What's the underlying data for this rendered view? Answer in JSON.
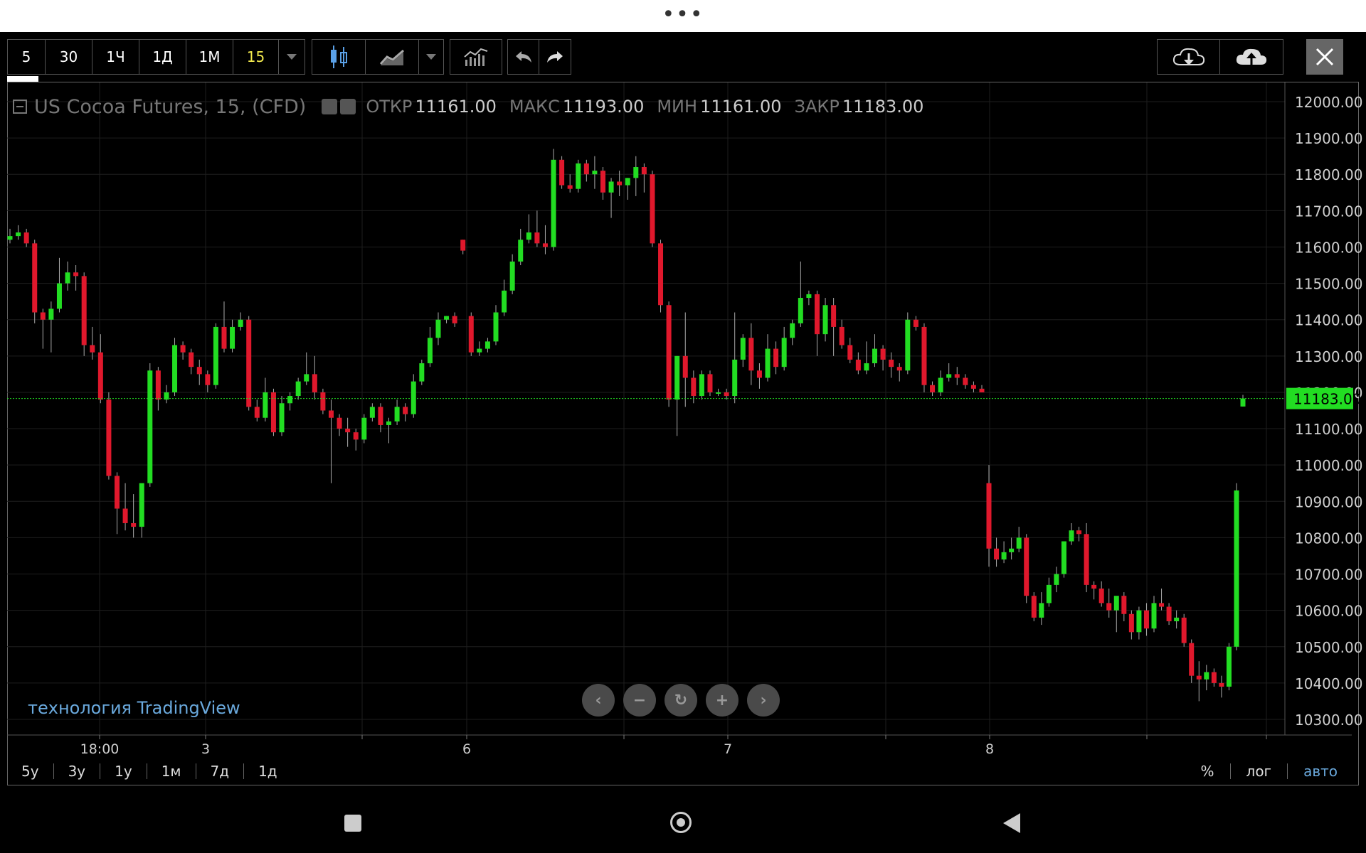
{
  "toolbar": {
    "intervals": [
      "5",
      "30",
      "1Ч",
      "1Д",
      "1М",
      "15"
    ],
    "active_interval": "15"
  },
  "legend": {
    "title": "US Cocoa Futures, 15, (CFD)",
    "open_label": "ОТКР",
    "open_value": "11161.00",
    "high_label": "МАКС",
    "high_value": "11193.00",
    "low_label": "МИН",
    "low_value": "11161.00",
    "close_label": "ЗАКР",
    "close_value": "11183.00"
  },
  "watermark": "технология TradingView",
  "ranges": [
    "5y",
    "3y",
    "1y",
    "1м",
    "7д",
    "1д"
  ],
  "scale_options": [
    "%",
    "лог",
    "авто"
  ],
  "active_scale": "авто",
  "colors": {
    "up": "#22dd22",
    "down": "#e0182c",
    "last_price": "#22dd22",
    "accent": "#6aa9dd",
    "active_interval": "#f2e94e"
  },
  "icons": [
    "chevron-down-icon",
    "candles-icon",
    "line-chart-icon",
    "indicators-icon",
    "undo-icon",
    "redo-icon",
    "cloud-download-icon",
    "cloud-upload-icon",
    "close-icon",
    "scroll-left-icon",
    "zoom-out-icon",
    "reset-icon",
    "zoom-in-icon",
    "scroll-right-icon"
  ],
  "chart_data": {
    "type": "candlestick",
    "symbol": "US Cocoa Futures",
    "interval": "15",
    "y_range": [
      10250,
      12050
    ],
    "y_ticks": [
      "12000.00",
      "11900.00",
      "11800.00",
      "11700.00",
      "11600.00",
      "11500.00",
      "11400.00",
      "11300.00",
      "11200.00",
      "11100.00",
      "11000.00",
      "10900.00",
      "10800.00",
      "10700.00",
      "10600.00",
      "10500.00",
      "10400.00",
      "10300.00"
    ],
    "x_ticks": [
      "18:00",
      "3",
      "6",
      "7",
      "8"
    ],
    "last_price": 11183.0,
    "last_price_label": "11183.00",
    "candles": [
      [
        11620,
        11650,
        11610,
        11630
      ],
      [
        11630,
        11660,
        11620,
        11640
      ],
      [
        11640,
        11650,
        11600,
        11610
      ],
      [
        11610,
        11620,
        11390,
        11420
      ],
      [
        11420,
        11430,
        11320,
        11400
      ],
      [
        11400,
        11450,
        11310,
        11430
      ],
      [
        11430,
        11570,
        11420,
        11500
      ],
      [
        11500,
        11560,
        11480,
        11530
      ],
      [
        11530,
        11550,
        11480,
        11520
      ],
      [
        11520,
        11530,
        11300,
        11330
      ],
      [
        11330,
        11380,
        11290,
        11310
      ],
      [
        11310,
        11360,
        11170,
        11180
      ],
      [
        11180,
        11200,
        10960,
        10970
      ],
      [
        10970,
        10980,
        10810,
        10880
      ],
      [
        10880,
        10950,
        10820,
        10840
      ],
      [
        10840,
        10920,
        10800,
        10830
      ],
      [
        10830,
        10910,
        10800,
        10950
      ],
      [
        10950,
        11280,
        10940,
        11260
      ],
      [
        11260,
        11270,
        11150,
        11180
      ],
      [
        11180,
        11220,
        11170,
        11200
      ],
      [
        11200,
        11350,
        11190,
        11330
      ],
      [
        11330,
        11340,
        11290,
        11310
      ],
      [
        11310,
        11320,
        11250,
        11270
      ],
      [
        11270,
        11290,
        11220,
        11250
      ],
      [
        11250,
        11260,
        11200,
        11220
      ],
      [
        11220,
        11390,
        11210,
        11380
      ],
      [
        11380,
        11450,
        11310,
        11320
      ],
      [
        11320,
        11400,
        11310,
        11380
      ],
      [
        11380,
        11420,
        11370,
        11400
      ],
      [
        11400,
        11410,
        11150,
        11160
      ],
      [
        11160,
        11180,
        11120,
        11130
      ],
      [
        11130,
        11240,
        11120,
        11200
      ],
      [
        11200,
        11210,
        11080,
        11090
      ],
      [
        11090,
        11190,
        11080,
        11170
      ],
      [
        11170,
        11200,
        11150,
        11190
      ],
      [
        11190,
        11240,
        11180,
        11230
      ],
      [
        11230,
        11310,
        11220,
        11250
      ],
      [
        11250,
        11300,
        11180,
        11200
      ],
      [
        11200,
        11210,
        11140,
        11150
      ],
      [
        11150,
        11180,
        10950,
        11130
      ],
      [
        11130,
        11140,
        11080,
        11100
      ],
      [
        11100,
        11130,
        11050,
        11090
      ],
      [
        11090,
        11100,
        11040,
        11070
      ],
      [
        11070,
        11140,
        11060,
        11130
      ],
      [
        11130,
        11170,
        11120,
        11160
      ],
      [
        11160,
        11170,
        11090,
        11110
      ],
      [
        11110,
        11130,
        11060,
        11120
      ],
      [
        11120,
        11180,
        11110,
        11160
      ],
      [
        11160,
        11170,
        11120,
        11140
      ],
      [
        11140,
        11250,
        11130,
        11230
      ],
      [
        11230,
        11290,
        11220,
        11280
      ],
      [
        11280,
        11380,
        11270,
        11350
      ],
      [
        11350,
        11420,
        11330,
        11400
      ],
      [
        11400,
        11410,
        11390,
        11410
      ],
      [
        11410,
        11420,
        11380,
        11390
      ],
      [
        11620,
        11620,
        11580,
        11590
      ],
      [
        11410,
        11420,
        11300,
        11310
      ],
      [
        11310,
        11340,
        11300,
        11320
      ],
      [
        11320,
        11350,
        11310,
        11340
      ],
      [
        11340,
        11440,
        11330,
        11420
      ],
      [
        11420,
        11510,
        11410,
        11480
      ],
      [
        11480,
        11580,
        11470,
        11560
      ],
      [
        11560,
        11650,
        11550,
        11620
      ],
      [
        11620,
        11690,
        11610,
        11640
      ],
      [
        11640,
        11700,
        11600,
        11610
      ],
      [
        11610,
        11660,
        11580,
        11600
      ],
      [
        11600,
        11870,
        11590,
        11840
      ],
      [
        11840,
        11850,
        11760,
        11770
      ],
      [
        11770,
        11800,
        11750,
        11760
      ],
      [
        11760,
        11840,
        11750,
        11830
      ],
      [
        11830,
        11840,
        11780,
        11800
      ],
      [
        11800,
        11850,
        11760,
        11810
      ],
      [
        11810,
        11820,
        11730,
        11750
      ],
      [
        11750,
        11790,
        11680,
        11780
      ],
      [
        11780,
        11810,
        11740,
        11770
      ],
      [
        11770,
        11790,
        11730,
        11790
      ],
      [
        11790,
        11850,
        11740,
        11820
      ],
      [
        11820,
        11830,
        11750,
        11800
      ],
      [
        11800,
        11810,
        11600,
        11610
      ],
      [
        11610,
        11620,
        11420,
        11440
      ],
      [
        11440,
        11450,
        11160,
        11180
      ],
      [
        11180,
        11300,
        11080,
        11300
      ],
      [
        11300,
        11420,
        11160,
        11240
      ],
      [
        11240,
        11260,
        11170,
        11190
      ],
      [
        11190,
        11260,
        11180,
        11250
      ],
      [
        11250,
        11260,
        11190,
        11200
      ],
      [
        11200,
        11210,
        11190,
        11200
      ],
      [
        11200,
        11210,
        11180,
        11190
      ],
      [
        11190,
        11420,
        11170,
        11290
      ],
      [
        11290,
        11360,
        11270,
        11350
      ],
      [
        11350,
        11390,
        11220,
        11260
      ],
      [
        11260,
        11280,
        11210,
        11240
      ],
      [
        11240,
        11360,
        11230,
        11320
      ],
      [
        11320,
        11340,
        11250,
        11270
      ],
      [
        11270,
        11380,
        11260,
        11350
      ],
      [
        11350,
        11400,
        11330,
        11390
      ],
      [
        11390,
        11560,
        11380,
        11460
      ],
      [
        11460,
        11480,
        11440,
        11470
      ],
      [
        11470,
        11480,
        11300,
        11360
      ],
      [
        11360,
        11460,
        11340,
        11440
      ],
      [
        11440,
        11460,
        11300,
        11380
      ],
      [
        11380,
        11400,
        11320,
        11330
      ],
      [
        11330,
        11350,
        11280,
        11290
      ],
      [
        11290,
        11310,
        11250,
        11260
      ],
      [
        11260,
        11340,
        11250,
        11280
      ],
      [
        11280,
        11360,
        11270,
        11320
      ],
      [
        11320,
        11330,
        11260,
        11290
      ],
      [
        11290,
        11310,
        11240,
        11270
      ],
      [
        11270,
        11280,
        11230,
        11260
      ],
      [
        11260,
        11420,
        11250,
        11400
      ],
      [
        11400,
        11410,
        11370,
        11380
      ],
      [
        11380,
        11390,
        11200,
        11220
      ],
      [
        11220,
        11230,
        11190,
        11200
      ],
      [
        11200,
        11260,
        11190,
        11240
      ],
      [
        11240,
        11280,
        11230,
        11250
      ],
      [
        11250,
        11270,
        11220,
        11240
      ],
      [
        11240,
        11250,
        11210,
        11220
      ],
      [
        11220,
        11230,
        11200,
        11210
      ],
      [
        11210,
        11220,
        11200,
        11200
      ]
    ],
    "candles_day8": [
      [
        10950,
        11000,
        10720,
        10770
      ],
      [
        10770,
        10800,
        10720,
        10740
      ],
      [
        10740,
        10790,
        10730,
        10760
      ],
      [
        10760,
        10800,
        10740,
        10770
      ],
      [
        10770,
        10830,
        10760,
        10800
      ],
      [
        10800,
        10810,
        10620,
        10640
      ],
      [
        10640,
        10650,
        10570,
        10580
      ],
      [
        10580,
        10650,
        10560,
        10620
      ],
      [
        10620,
        10690,
        10610,
        10670
      ],
      [
        10670,
        10720,
        10650,
        10700
      ],
      [
        10700,
        10790,
        10690,
        10790
      ],
      [
        10790,
        10840,
        10780,
        10820
      ],
      [
        10820,
        10830,
        10790,
        10810
      ],
      [
        10810,
        10840,
        10650,
        10670
      ],
      [
        10670,
        10680,
        10630,
        10660
      ],
      [
        10660,
        10680,
        10610,
        10620
      ],
      [
        10620,
        10660,
        10580,
        10600
      ],
      [
        10600,
        10620,
        10540,
        10640
      ],
      [
        10640,
        10650,
        10570,
        10590
      ],
      [
        10590,
        10600,
        10520,
        10540
      ],
      [
        10540,
        10610,
        10520,
        10600
      ],
      [
        10600,
        10620,
        10530,
        10550
      ],
      [
        10550,
        10640,
        10540,
        10620
      ],
      [
        10620,
        10660,
        10600,
        10610
      ],
      [
        10610,
        10620,
        10560,
        10570
      ],
      [
        10570,
        10600,
        10550,
        10580
      ],
      [
        10580,
        10590,
        10500,
        10510
      ],
      [
        10510,
        10520,
        10400,
        10420
      ],
      [
        10420,
        10460,
        10350,
        10410
      ],
      [
        10410,
        10450,
        10380,
        10430
      ],
      [
        10430,
        10440,
        10390,
        10400
      ],
      [
        10400,
        10420,
        10360,
        10390
      ],
      [
        10390,
        10510,
        10380,
        10500
      ],
      [
        10500,
        10950,
        10490,
        10930
      ]
    ],
    "last_candle": [
      11161,
      11193,
      11161,
      11183
    ]
  }
}
